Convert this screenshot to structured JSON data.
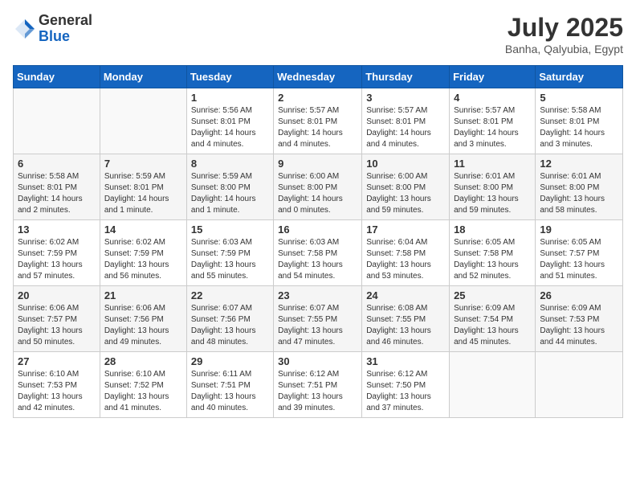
{
  "header": {
    "logo_general": "General",
    "logo_blue": "Blue",
    "month_year": "July 2025",
    "location": "Banha, Qalyubia, Egypt"
  },
  "days_of_week": [
    "Sunday",
    "Monday",
    "Tuesday",
    "Wednesday",
    "Thursday",
    "Friday",
    "Saturday"
  ],
  "weeks": [
    [
      {
        "day": "",
        "info": ""
      },
      {
        "day": "",
        "info": ""
      },
      {
        "day": "1",
        "info": "Sunrise: 5:56 AM\nSunset: 8:01 PM\nDaylight: 14 hours and 4 minutes."
      },
      {
        "day": "2",
        "info": "Sunrise: 5:57 AM\nSunset: 8:01 PM\nDaylight: 14 hours and 4 minutes."
      },
      {
        "day": "3",
        "info": "Sunrise: 5:57 AM\nSunset: 8:01 PM\nDaylight: 14 hours and 4 minutes."
      },
      {
        "day": "4",
        "info": "Sunrise: 5:57 AM\nSunset: 8:01 PM\nDaylight: 14 hours and 3 minutes."
      },
      {
        "day": "5",
        "info": "Sunrise: 5:58 AM\nSunset: 8:01 PM\nDaylight: 14 hours and 3 minutes."
      }
    ],
    [
      {
        "day": "6",
        "info": "Sunrise: 5:58 AM\nSunset: 8:01 PM\nDaylight: 14 hours and 2 minutes."
      },
      {
        "day": "7",
        "info": "Sunrise: 5:59 AM\nSunset: 8:01 PM\nDaylight: 14 hours and 1 minute."
      },
      {
        "day": "8",
        "info": "Sunrise: 5:59 AM\nSunset: 8:00 PM\nDaylight: 14 hours and 1 minute."
      },
      {
        "day": "9",
        "info": "Sunrise: 6:00 AM\nSunset: 8:00 PM\nDaylight: 14 hours and 0 minutes."
      },
      {
        "day": "10",
        "info": "Sunrise: 6:00 AM\nSunset: 8:00 PM\nDaylight: 13 hours and 59 minutes."
      },
      {
        "day": "11",
        "info": "Sunrise: 6:01 AM\nSunset: 8:00 PM\nDaylight: 13 hours and 59 minutes."
      },
      {
        "day": "12",
        "info": "Sunrise: 6:01 AM\nSunset: 8:00 PM\nDaylight: 13 hours and 58 minutes."
      }
    ],
    [
      {
        "day": "13",
        "info": "Sunrise: 6:02 AM\nSunset: 7:59 PM\nDaylight: 13 hours and 57 minutes."
      },
      {
        "day": "14",
        "info": "Sunrise: 6:02 AM\nSunset: 7:59 PM\nDaylight: 13 hours and 56 minutes."
      },
      {
        "day": "15",
        "info": "Sunrise: 6:03 AM\nSunset: 7:59 PM\nDaylight: 13 hours and 55 minutes."
      },
      {
        "day": "16",
        "info": "Sunrise: 6:03 AM\nSunset: 7:58 PM\nDaylight: 13 hours and 54 minutes."
      },
      {
        "day": "17",
        "info": "Sunrise: 6:04 AM\nSunset: 7:58 PM\nDaylight: 13 hours and 53 minutes."
      },
      {
        "day": "18",
        "info": "Sunrise: 6:05 AM\nSunset: 7:58 PM\nDaylight: 13 hours and 52 minutes."
      },
      {
        "day": "19",
        "info": "Sunrise: 6:05 AM\nSunset: 7:57 PM\nDaylight: 13 hours and 51 minutes."
      }
    ],
    [
      {
        "day": "20",
        "info": "Sunrise: 6:06 AM\nSunset: 7:57 PM\nDaylight: 13 hours and 50 minutes."
      },
      {
        "day": "21",
        "info": "Sunrise: 6:06 AM\nSunset: 7:56 PM\nDaylight: 13 hours and 49 minutes."
      },
      {
        "day": "22",
        "info": "Sunrise: 6:07 AM\nSunset: 7:56 PM\nDaylight: 13 hours and 48 minutes."
      },
      {
        "day": "23",
        "info": "Sunrise: 6:07 AM\nSunset: 7:55 PM\nDaylight: 13 hours and 47 minutes."
      },
      {
        "day": "24",
        "info": "Sunrise: 6:08 AM\nSunset: 7:55 PM\nDaylight: 13 hours and 46 minutes."
      },
      {
        "day": "25",
        "info": "Sunrise: 6:09 AM\nSunset: 7:54 PM\nDaylight: 13 hours and 45 minutes."
      },
      {
        "day": "26",
        "info": "Sunrise: 6:09 AM\nSunset: 7:53 PM\nDaylight: 13 hours and 44 minutes."
      }
    ],
    [
      {
        "day": "27",
        "info": "Sunrise: 6:10 AM\nSunset: 7:53 PM\nDaylight: 13 hours and 42 minutes."
      },
      {
        "day": "28",
        "info": "Sunrise: 6:10 AM\nSunset: 7:52 PM\nDaylight: 13 hours and 41 minutes."
      },
      {
        "day": "29",
        "info": "Sunrise: 6:11 AM\nSunset: 7:51 PM\nDaylight: 13 hours and 40 minutes."
      },
      {
        "day": "30",
        "info": "Sunrise: 6:12 AM\nSunset: 7:51 PM\nDaylight: 13 hours and 39 minutes."
      },
      {
        "day": "31",
        "info": "Sunrise: 6:12 AM\nSunset: 7:50 PM\nDaylight: 13 hours and 37 minutes."
      },
      {
        "day": "",
        "info": ""
      },
      {
        "day": "",
        "info": ""
      }
    ]
  ]
}
